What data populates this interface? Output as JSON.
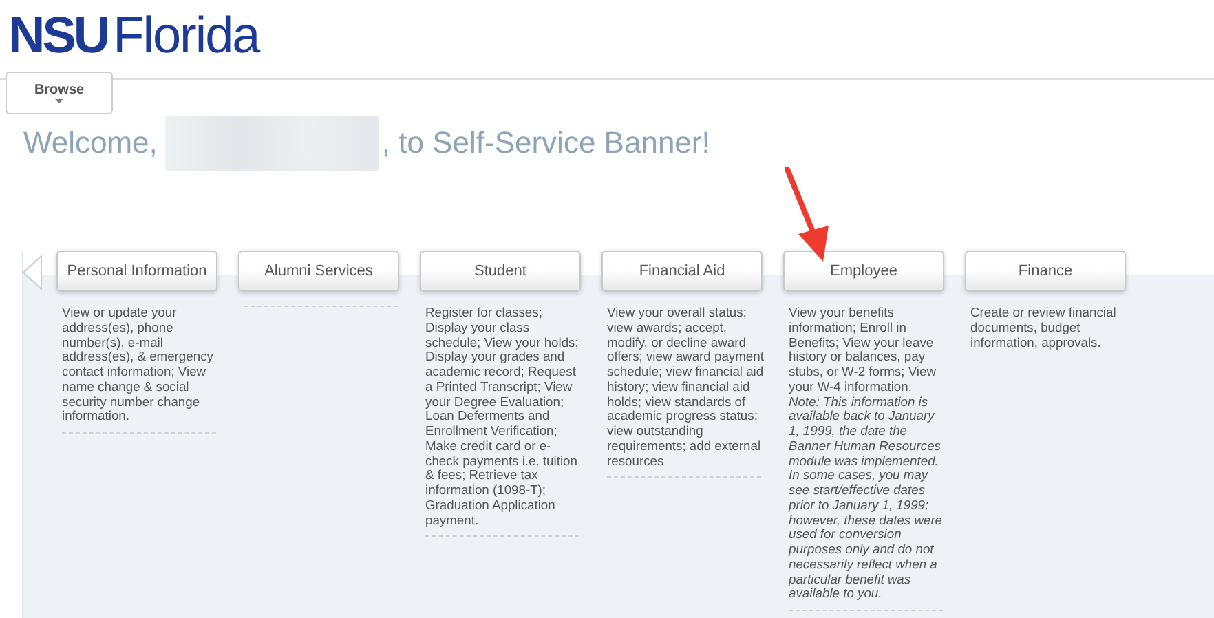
{
  "logo": {
    "bold": "NSU",
    "light": "Florida"
  },
  "browse": {
    "label": "Browse"
  },
  "welcome": {
    "before": "Welcome,",
    "name_redacted": true,
    "after": ", to Self-Service Banner!"
  },
  "categories": [
    {
      "title": "Personal Information",
      "description": "View or update your address(es), phone number(s), e-mail address(es), & emergency contact information; View name change & social security number change information.",
      "rule": true
    },
    {
      "title": "Alumni Services",
      "rule": true
    },
    {
      "title": "Student",
      "description": "Register for classes; Display your class schedule; View your holds; Display your grades and academic record; Request a Printed Transcript; View your Degree Evaluation; Loan Deferments and Enrollment Verification; Make credit card or e-check payments i.e. tuition & fees; Retrieve tax information (1098-T); Graduation Application payment.",
      "rule": true
    },
    {
      "title": "Financial Aid",
      "description": "View your overall status; view awards; accept, modify, or decline award offers; view award payment schedule; view financial aid history; view financial aid holds; view standards of academic progress status; view outstanding requirements; add external resources",
      "rule": true
    },
    {
      "title": "Employee",
      "description": "View your benefits information; Enroll in Benefits; View your leave history or balances, pay stubs, or W-2 forms; View your W-4 information. *Note: This information is available back to January 1, 1999, the date the Banner Human Resources module was implemented. In some cases, you may see start/effective dates prior to January 1, 1999; however, these dates were used for conversion purposes only and do not necessarily reflect when a particular benefit was available to you.*",
      "rule": true
    },
    {
      "title": "Finance",
      "description": "Create or review financial documents, budget information, approvals.",
      "rule": false
    }
  ]
}
